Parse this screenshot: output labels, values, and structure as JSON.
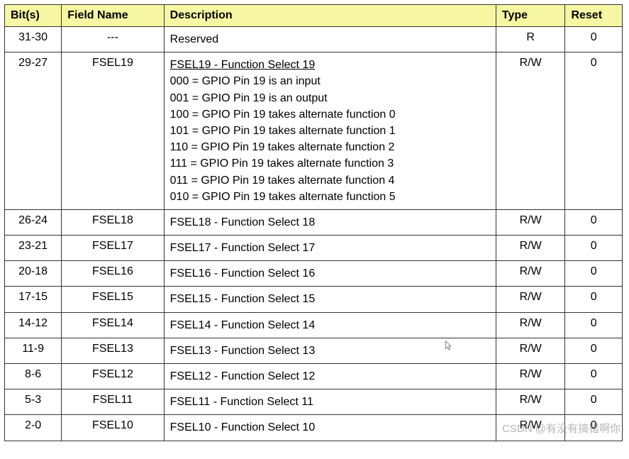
{
  "headers": {
    "bits": "Bit(s)",
    "field": "Field Name",
    "desc": "Description",
    "type": "Type",
    "reset": "Reset"
  },
  "rows": [
    {
      "bits": "31-30",
      "field": "---",
      "desc_title": "",
      "desc_lines": [
        "Reserved"
      ],
      "type": "R",
      "reset": "0"
    },
    {
      "bits": "29-27",
      "field": "FSEL19",
      "desc_title": "FSEL19 - Function Select 19",
      "desc_lines": [
        "000 = GPIO Pin 19 is an input",
        "001 = GPIO Pin 19 is an output",
        "100 = GPIO Pin 19 takes alternate function 0",
        "101 = GPIO Pin 19 takes alternate function 1",
        "110 = GPIO Pin 19 takes alternate function 2",
        "111 = GPIO Pin 19 takes alternate function 3",
        "011 = GPIO Pin 19 takes alternate function 4",
        "010 = GPIO Pin 19 takes alternate function 5"
      ],
      "type": "R/W",
      "reset": "0"
    },
    {
      "bits": "26-24",
      "field": "FSEL18",
      "desc_title": "",
      "desc_lines": [
        "FSEL18 - Function Select 18"
      ],
      "type": "R/W",
      "reset": "0"
    },
    {
      "bits": "23-21",
      "field": "FSEL17",
      "desc_title": "",
      "desc_lines": [
        "FSEL17 - Function Select 17"
      ],
      "type": "R/W",
      "reset": "0"
    },
    {
      "bits": "20-18",
      "field": "FSEL16",
      "desc_title": "",
      "desc_lines": [
        "FSEL16 - Function Select 16"
      ],
      "type": "R/W",
      "reset": "0"
    },
    {
      "bits": "17-15",
      "field": "FSEL15",
      "desc_title": "",
      "desc_lines": [
        "FSEL15 - Function Select 15"
      ],
      "type": "R/W",
      "reset": "0"
    },
    {
      "bits": "14-12",
      "field": "FSEL14",
      "desc_title": "",
      "desc_lines": [
        "FSEL14 - Function Select 14"
      ],
      "type": "R/W",
      "reset": "0"
    },
    {
      "bits": "11-9",
      "field": "FSEL13",
      "desc_title": "",
      "desc_lines": [
        "FSEL13 - Function Select 13"
      ],
      "type": "R/W",
      "reset": "0"
    },
    {
      "bits": "8-6",
      "field": "FSEL12",
      "desc_title": "",
      "desc_lines": [
        "FSEL12 - Function Select 12"
      ],
      "type": "R/W",
      "reset": "0"
    },
    {
      "bits": "5-3",
      "field": "FSEL11",
      "desc_title": "",
      "desc_lines": [
        "FSEL11 - Function Select 11"
      ],
      "type": "R/W",
      "reset": "0"
    },
    {
      "bits": "2-0",
      "field": "FSEL10",
      "desc_title": "",
      "desc_lines": [
        "FSEL10 - Function Select 10"
      ],
      "type": "R/W",
      "reset": "0"
    }
  ],
  "watermark": "CSDN @有没有搞错啊你"
}
